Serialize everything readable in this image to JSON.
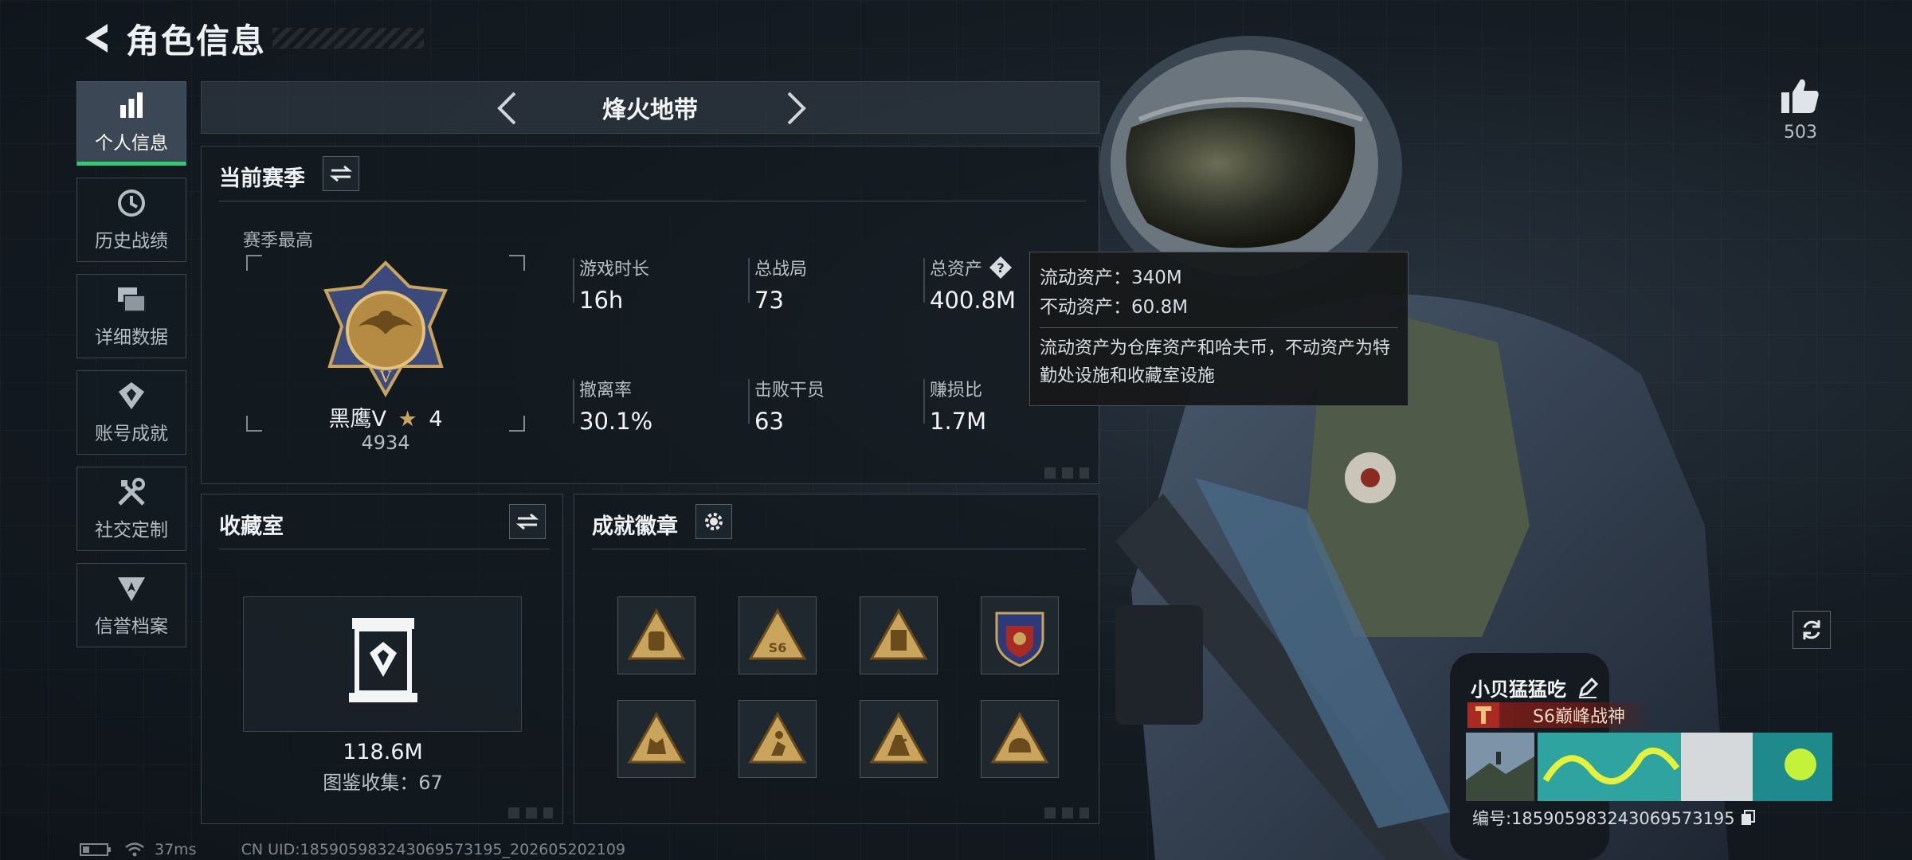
{
  "header": {
    "title": "角色信息"
  },
  "nav": {
    "items": [
      {
        "label": "个人信息",
        "icon": "bar-chart-icon",
        "active": true
      },
      {
        "label": "历史战绩",
        "icon": "history-clock-icon",
        "active": false
      },
      {
        "label": "详细数据",
        "icon": "cards-icon",
        "active": false
      },
      {
        "label": "账号成就",
        "icon": "achievement-icon",
        "active": false
      },
      {
        "label": "社交定制",
        "icon": "wrench-screwdriver-icon",
        "active": false
      },
      {
        "label": "信誉档案",
        "icon": "shield-emblem-icon",
        "active": false
      }
    ]
  },
  "mode": {
    "title": "烽火地带"
  },
  "season": {
    "title": "当前赛季",
    "subtitle": "赛季最高",
    "rank_name": "黑鹰V",
    "rank_stars": "4",
    "rank_score": "4934",
    "stats": {
      "play_time": {
        "label": "游戏时长",
        "value": "16h"
      },
      "total_matches": {
        "label": "总战局",
        "value": "73"
      },
      "total_assets": {
        "label": "总资产",
        "value": "400.8M"
      },
      "evac_rate": {
        "label": "撤离率",
        "value": "30.1%"
      },
      "kills": {
        "label": "击败干员",
        "value": "63"
      },
      "profit_ratio": {
        "label": "赚损比",
        "value": "1.7M"
      }
    }
  },
  "tooltip": {
    "liquid": "流动资产：340M",
    "fixed": "不动资产：60.8M",
    "desc": "流动资产为仓库资产和哈夫币，不动资产为特勤处设施和收藏室设施"
  },
  "vault": {
    "title": "收藏室",
    "value": "118.6M",
    "collection": "图鉴收集：67"
  },
  "achievements": {
    "title": "成就徽章",
    "medals": [
      "bag-medal-icon",
      "s6-medal-icon",
      "card-medal-icon",
      "eagle-shield-medal-icon",
      "hand-medal-icon",
      "runner-medal-icon",
      "soldier-medal-icon",
      "helmet-medal-icon"
    ]
  },
  "like": {
    "count": "503"
  },
  "player": {
    "name": "小贝猛猛吃",
    "title": "S6巅峰战神",
    "id_label": "编号:18590598324306957319​5"
  },
  "status": {
    "ping": "37ms",
    "uid": "CN UID:18590598324306957319​5_202605202109"
  },
  "colors": {
    "accent_green": "#2ecc71",
    "panel_bg": "#12191f",
    "title_red": "#7a1e1a",
    "medal_gold": "#c9a45c"
  }
}
